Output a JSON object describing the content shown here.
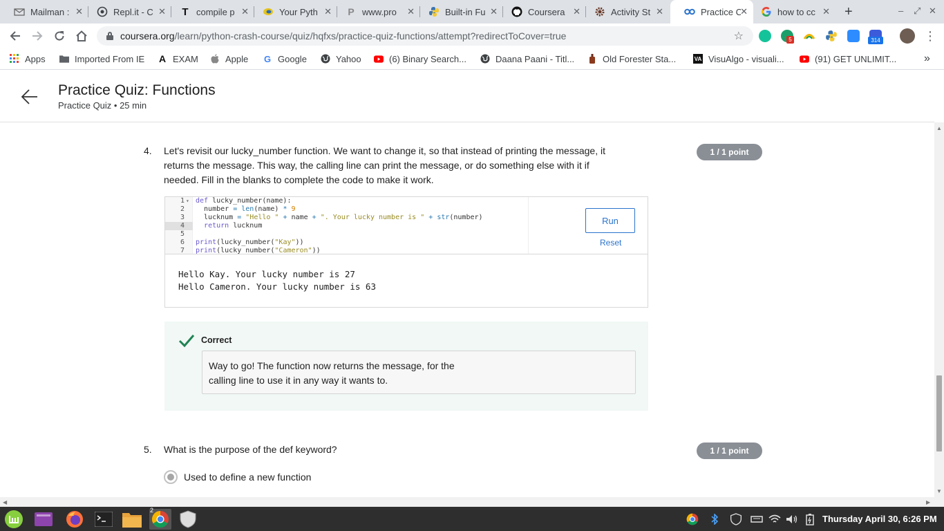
{
  "browser": {
    "tabs": [
      {
        "label": "Mailman :",
        "icon": "mailman-icon",
        "close": "✕"
      },
      {
        "label": "Repl.it - C",
        "icon": "replit-icon",
        "close": "✕"
      },
      {
        "label": "compile p",
        "icon": "t-icon",
        "close": "✕"
      },
      {
        "label": "Your Pyth",
        "icon": "python-ball-icon",
        "close": "✕"
      },
      {
        "label": "www.pro",
        "icon": "p-icon",
        "close": "✕"
      },
      {
        "label": "Built-in Fu",
        "icon": "python-icon",
        "close": "✕"
      },
      {
        "label": "Coursera",
        "icon": "github-icon",
        "close": "✕"
      },
      {
        "label": "Activity St",
        "icon": "gear-icon",
        "close": "✕"
      },
      {
        "label": "Practice C",
        "icon": "coursera-icon",
        "close": "✕",
        "active": true
      },
      {
        "label": "how to cc",
        "icon": "google-icon",
        "close": "✕"
      }
    ],
    "new_tab": "+",
    "window_controls": {
      "minimize": "–",
      "restore": "⤢",
      "close": "✕"
    },
    "url_host": "coursera.org",
    "url_path": "/learn/python-crash-course/quiz/hqfxs/practice-quiz-functions/attempt?redirectToCover=true",
    "extension_badges": {
      "grammarly_count": "5",
      "zoom_count": "314"
    },
    "bookmarks": [
      {
        "label": "Apps",
        "icon": "apps-grid-icon"
      },
      {
        "label": "Imported From IE",
        "icon": "folder-icon"
      },
      {
        "label": "EXAM",
        "icon": "a-logo-icon"
      },
      {
        "label": "Apple",
        "icon": "apple-icon"
      },
      {
        "label": "Google",
        "icon": "google-icon"
      },
      {
        "label": "Yahoo",
        "icon": "globe-icon"
      },
      {
        "label": "(6) Binary Search...",
        "icon": "youtube-icon"
      },
      {
        "label": "Daana Paani - Titl...",
        "icon": "globe-icon"
      },
      {
        "label": "Old Forester Sta...",
        "icon": "bottle-icon"
      },
      {
        "label": "VisuAlgo - visuali...",
        "icon": "va-icon"
      },
      {
        "label": "(91) GET UNLIMIT...",
        "icon": "youtube-icon"
      }
    ],
    "bookmarks_overflow": "»"
  },
  "quiz": {
    "title": "Practice Quiz: Functions",
    "subtitle": "Practice Quiz • 25 min"
  },
  "question4": {
    "number": "4.",
    "text_lines": [
      "Let's revisit our lucky_number function. We want to change it, so that instead of printing the message, it",
      "returns the message. This way, the calling line can print the message, or do something else with it if",
      "needed. Fill in the blanks to complete the code to make it work."
    ],
    "points": "1 / 1 point",
    "line_numbers": [
      "1",
      "2",
      "3",
      "4",
      "5",
      "6",
      "7"
    ],
    "run_label": "Run",
    "reset_label": "Reset",
    "output_lines": [
      "Hello Kay. Your lucky number is 27",
      "Hello Cameron. Your lucky number is 63"
    ],
    "feedback_status": "Correct",
    "feedback_lines": [
      "Way to go! The function now returns the message, for the",
      "calling line to use it in any way it wants to."
    ]
  },
  "question5": {
    "number": "5.",
    "text": "What is the purpose of the def keyword?",
    "points": "1 / 1 point",
    "option": "Used to define a new function"
  },
  "taskbar": {
    "workspace_badge": "2",
    "clock": "Thursday April 30, 6:26 PM"
  }
}
